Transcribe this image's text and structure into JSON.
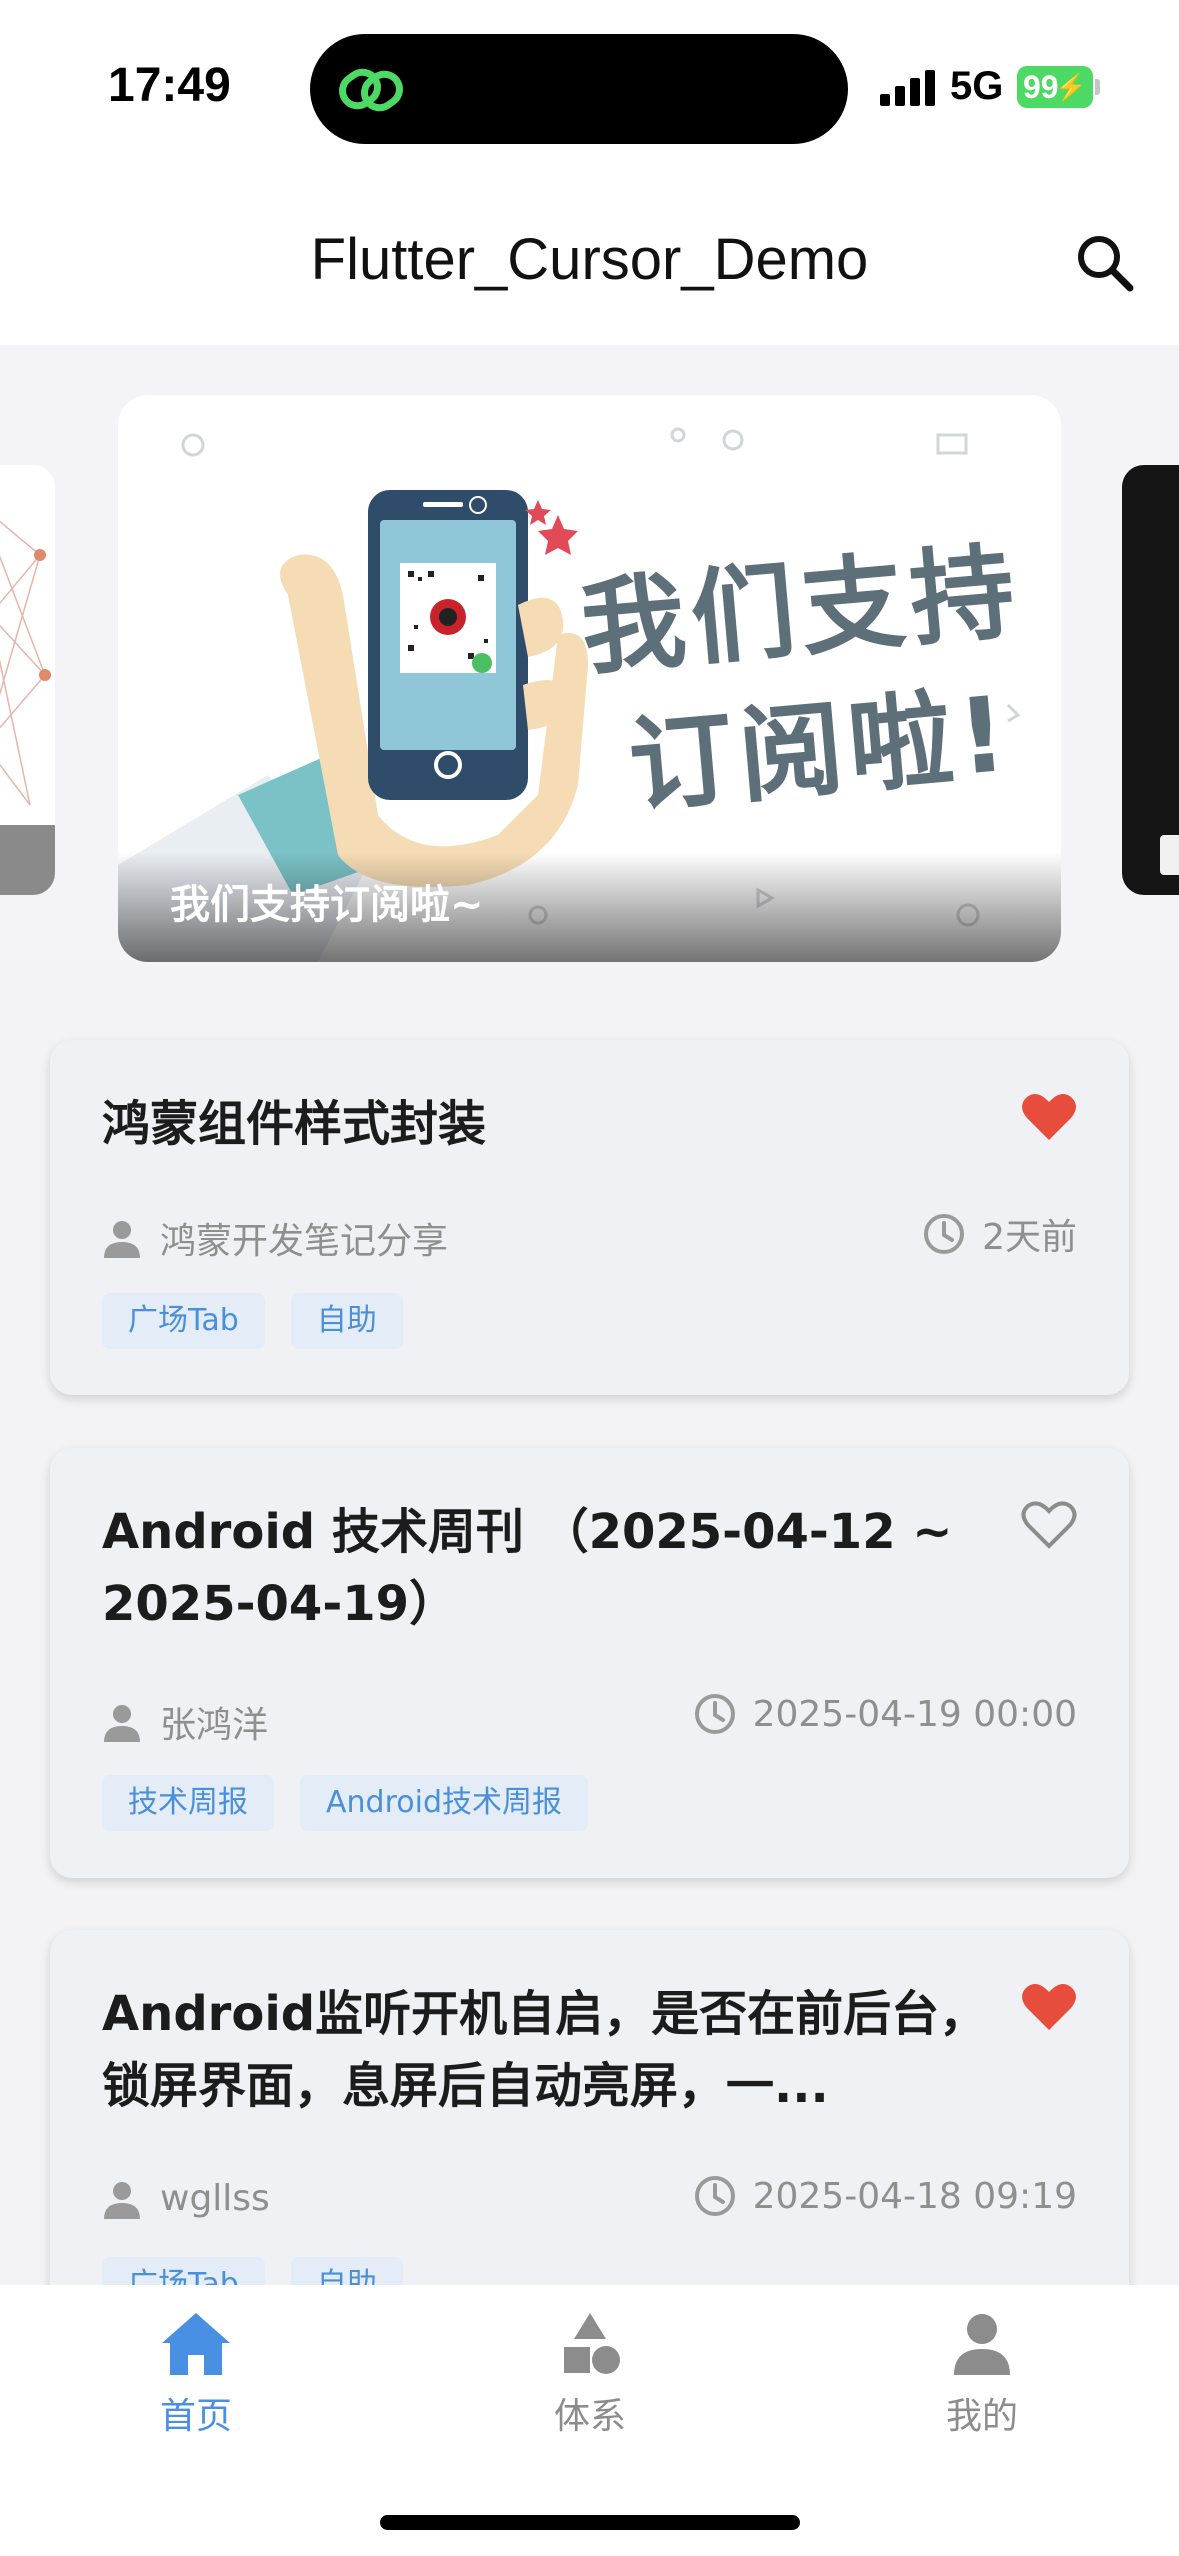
{
  "status_bar": {
    "time": "17:49",
    "network": "5G",
    "battery": "99",
    "island_icon": "link-chain-icon"
  },
  "app_bar": {
    "title": "Flutter_Cursor_Demo",
    "search_icon": "search-icon"
  },
  "banner": {
    "caption": "我们支持订阅啦~",
    "headline_line1": "我们支持",
    "headline_line2": "订阅啦!"
  },
  "articles": [
    {
      "title": "鸿蒙组件样式封装",
      "author": "鸿蒙开发笔记分享",
      "time": "2天前",
      "favorited": true,
      "tags": [
        "广场Tab",
        "自助"
      ]
    },
    {
      "title": "Android 技术周刊 （2025-04-12 ~ 2025-04-19）",
      "author": "张鸿洋",
      "time": "2025-04-19 00:00",
      "favorited": false,
      "tags": [
        "技术周报",
        "Android技术周报"
      ]
    },
    {
      "title": "Android监听开机自启，是否在前后台，锁屏界面，息屏后自动亮屏，一...",
      "author": "wgllss",
      "time": "2025-04-18 09:19",
      "favorited": true,
      "tags": [
        "广场Tab",
        "自助"
      ]
    }
  ],
  "bottom_nav": {
    "items": [
      {
        "label": "首页",
        "icon": "home-icon",
        "active": true
      },
      {
        "label": "体系",
        "icon": "shapes-icon",
        "active": false
      },
      {
        "label": "我的",
        "icon": "person-icon",
        "active": false
      }
    ]
  },
  "colors": {
    "accent": "#4a90e2",
    "favorite": "#e74c3c",
    "card_bg": "#f0f1f5",
    "tag_bg": "#e3ecf7"
  }
}
